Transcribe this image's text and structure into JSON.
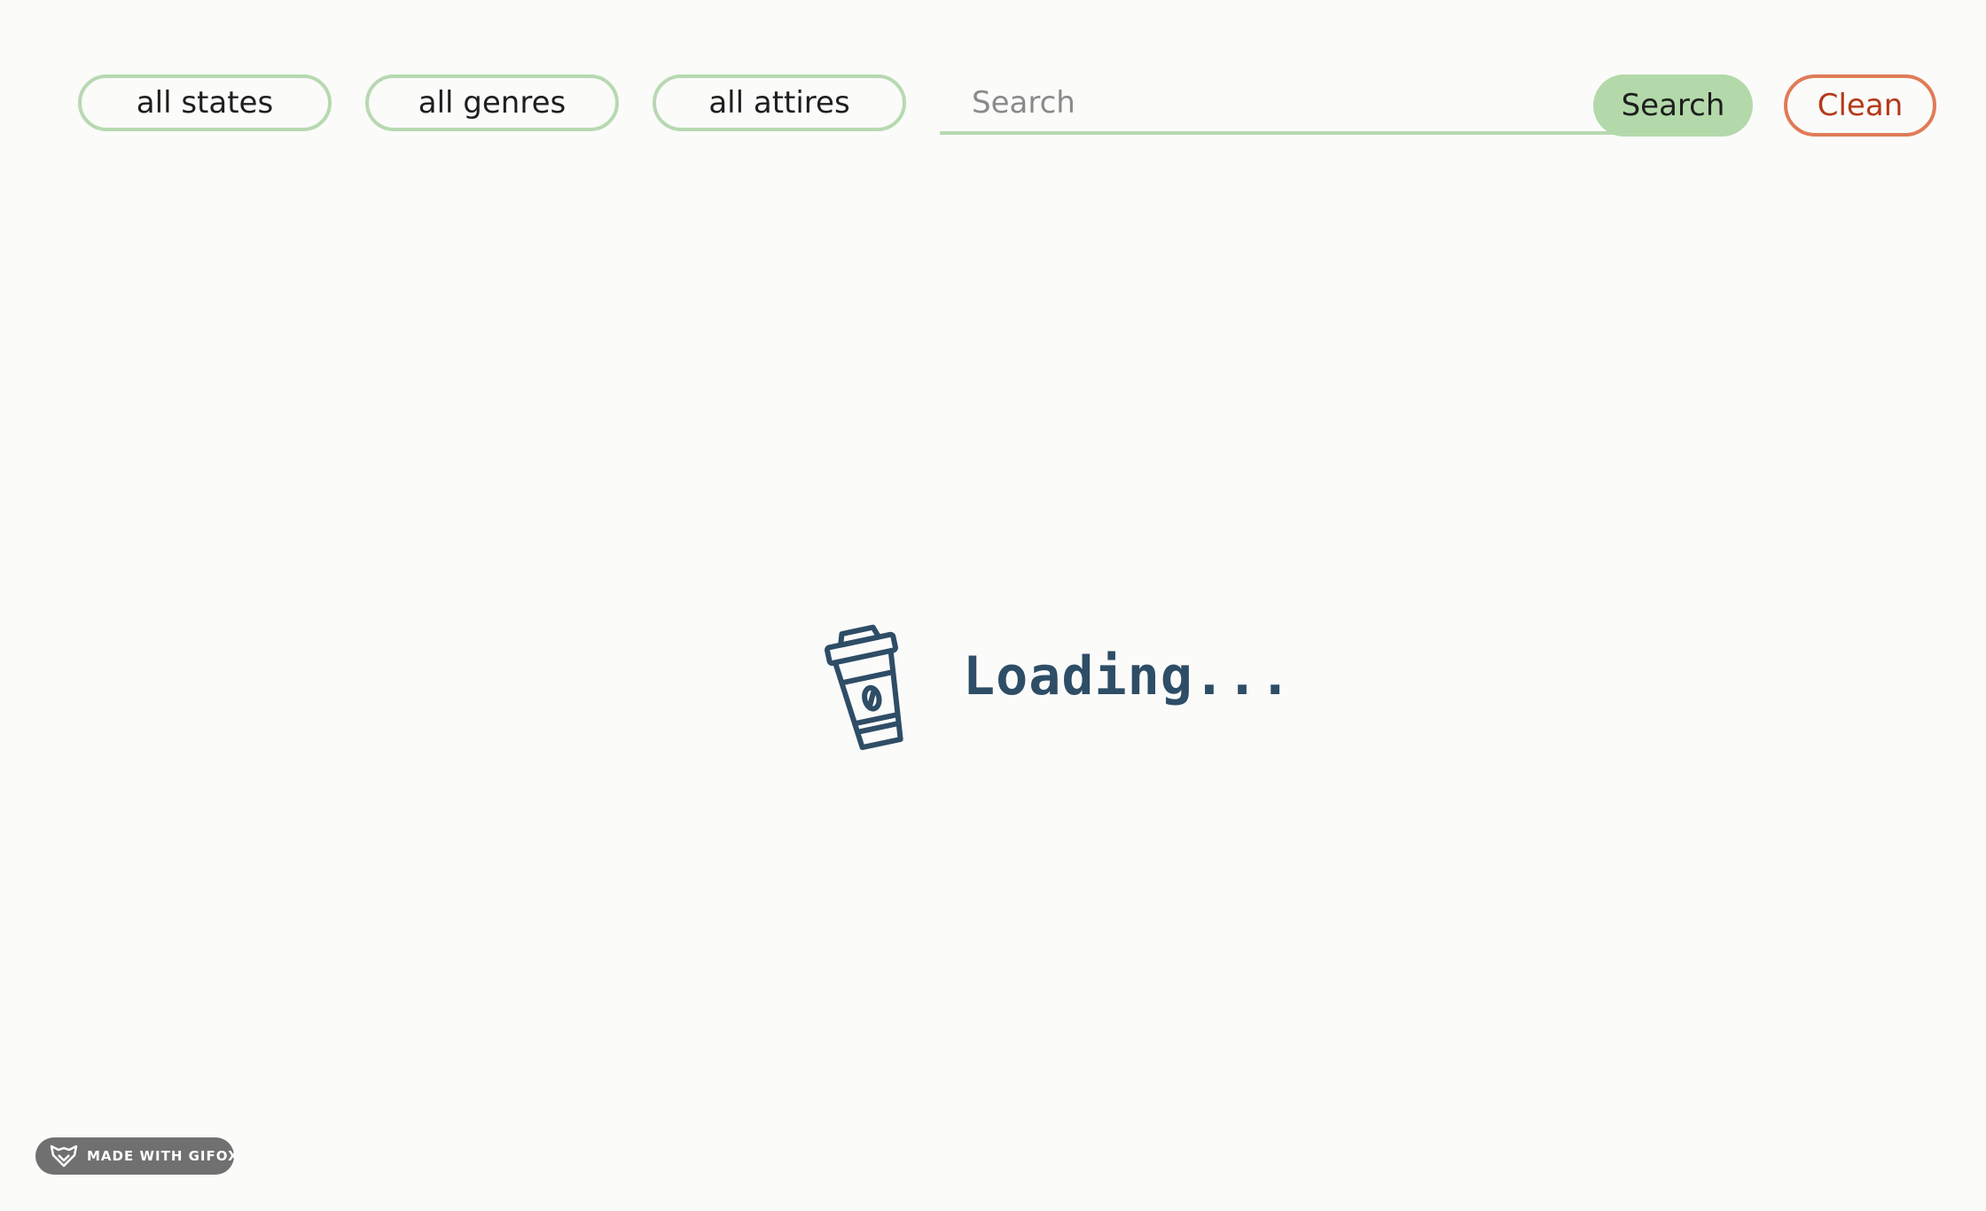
{
  "filters": {
    "states_label": "all states",
    "genres_label": "all genres",
    "attires_label": "all attires"
  },
  "search": {
    "placeholder": "Search",
    "value": "",
    "button_label": "Search"
  },
  "clean_label": "Clean",
  "loading": {
    "icon": "coffee-cup-icon",
    "text": "Loading..."
  },
  "badge": {
    "icon": "fox-icon",
    "text": "MADE WITH GIFOX"
  },
  "colors": {
    "background": "#fbfbfa",
    "pill_border": "#b7d9b1",
    "search_button_bg": "#b3d9aa",
    "clean_border": "#e07b58",
    "clean_text": "#b33a1a",
    "loading_text": "#2e4d66"
  }
}
